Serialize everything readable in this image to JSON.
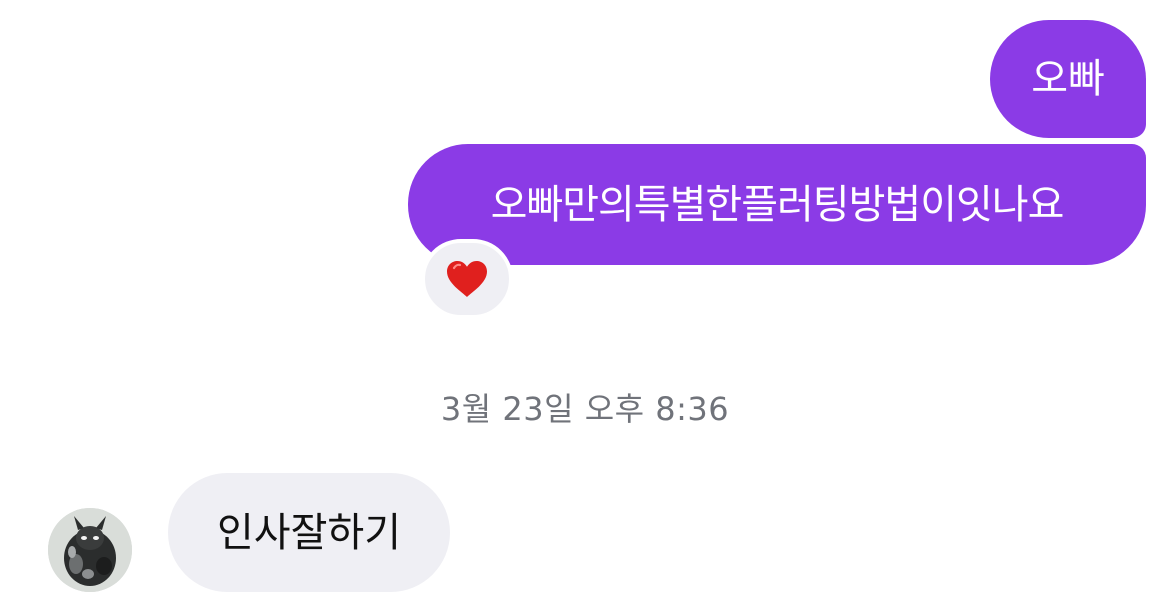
{
  "conversation": {
    "messages": [
      {
        "direction": "sent",
        "text": "오빠"
      },
      {
        "direction": "sent",
        "text": "오빠만의특별한플러팅방법이잇나요",
        "reaction": "heart-emoji"
      },
      {
        "direction": "received",
        "text": "인사잘하기"
      }
    ],
    "timestamp": "3월 23일 오후 8:36"
  },
  "colors": {
    "sent_bubble": "#8b3be6",
    "received_bubble": "#efeff4",
    "reaction_heart": "#e0201e",
    "timestamp_text": "#70737a"
  }
}
